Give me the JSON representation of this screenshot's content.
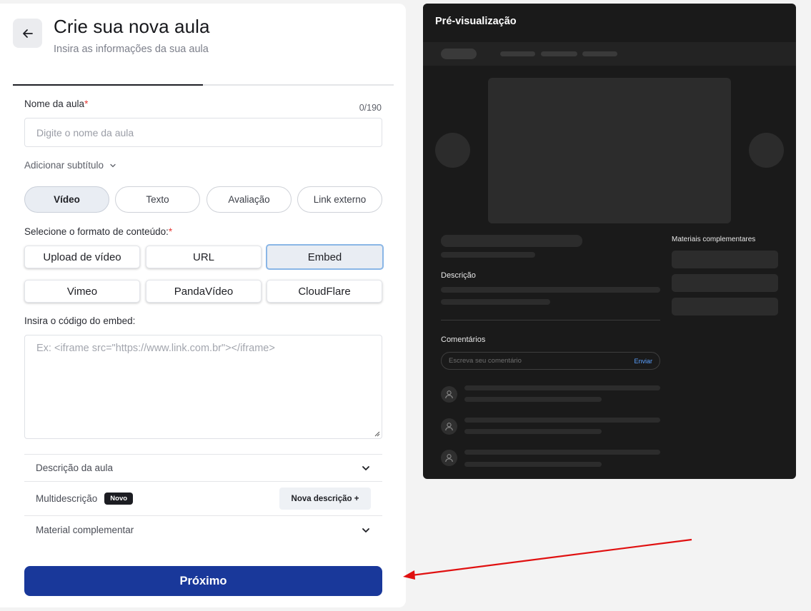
{
  "header": {
    "title": "Crie sua nova aula",
    "subtitle": "Insira as informações da sua aula"
  },
  "form": {
    "name_label": "Nome da aula",
    "required_mark": "*",
    "counter": "0/190",
    "name_placeholder": "Digite o nome da aula",
    "add_subtitle": "Adicionar subtítulo",
    "content_types": [
      "Vídeo",
      "Texto",
      "Avaliação",
      "Link externo"
    ],
    "active_content_type": "Vídeo",
    "format_label": "Selecione o formato de conteúdo:",
    "formats": [
      "Upload de vídeo",
      "URL",
      "Embed",
      "Vimeo",
      "PandaVídeo",
      "CloudFlare"
    ],
    "active_format": "Embed",
    "embed_label": "Insira o código do embed:",
    "embed_placeholder": "Ex: <iframe src=\"https://www.link.com.br\"></iframe>",
    "accordion": {
      "description": "Descrição da aula",
      "multi": "Multidescrição",
      "multi_badge": "Novo",
      "multi_button": "Nova descrição +",
      "material": "Material complementar"
    },
    "next_button": "Próximo"
  },
  "preview": {
    "title": "Pré-visualização",
    "materials_label": "Materiais complementares",
    "description_label": "Descrição",
    "comments_label": "Comentários",
    "comment_placeholder": "Escreva seu comentário",
    "send_label": "Enviar"
  },
  "icons": {
    "back": "arrow-left-icon",
    "chevron": "chevron-down-icon",
    "user": "user-icon"
  },
  "colors": {
    "primary": "#19389a",
    "required": "#e53935",
    "preview_bg": "#1a1a1a",
    "active_format_border": "#8ab6e6",
    "annotation_arrow": "#e01010"
  }
}
